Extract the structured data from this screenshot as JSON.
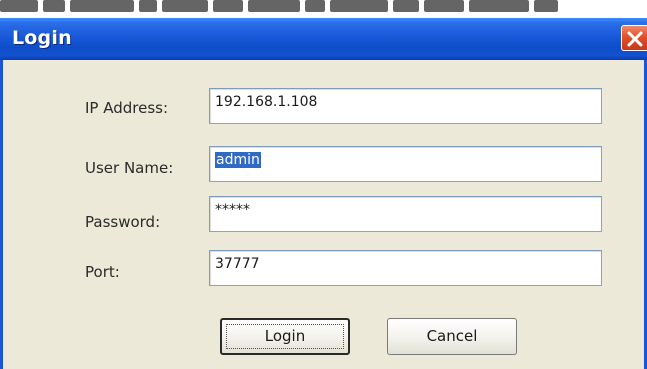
{
  "window": {
    "title": "Login",
    "close_icon": "close-icon"
  },
  "form": {
    "ip_address": {
      "label": "IP Address:",
      "value": "192.168.1.108"
    },
    "user_name": {
      "label": "User Name:",
      "value": "admin"
    },
    "password": {
      "label": "Password:",
      "value": "*****"
    },
    "port": {
      "label": "Port:",
      "value": "37777"
    }
  },
  "buttons": {
    "login_label": "Login",
    "cancel_label": "Cancel"
  },
  "colors": {
    "titlebar": "#1958d8",
    "close_button": "#e0502c",
    "dialog_background": "#ece9d8",
    "selection_highlight": "#316ac5"
  }
}
